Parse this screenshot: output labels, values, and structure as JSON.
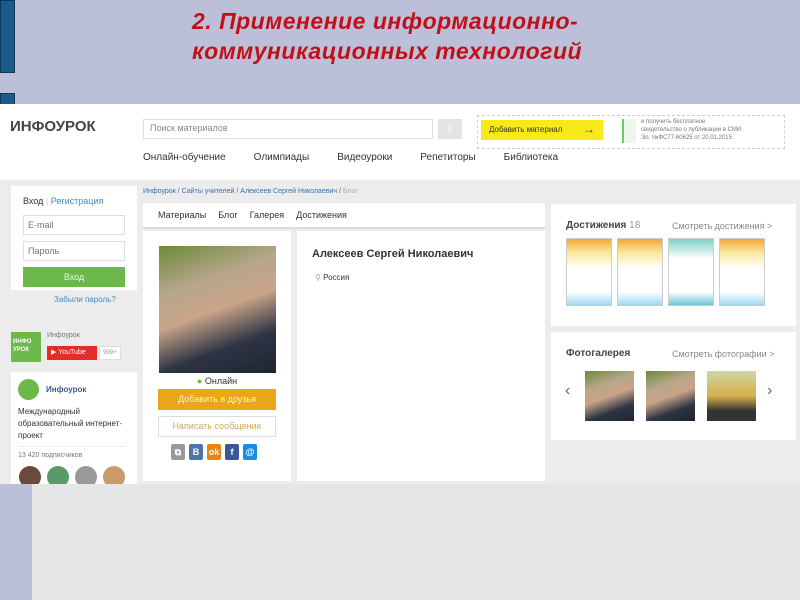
{
  "slide": {
    "title_line1": "2. Применение  информационно-",
    "title_line2": "коммуникационных технологий"
  },
  "site": {
    "logo": "ИНФОУРОК",
    "search_placeholder": "Поиск материалов",
    "add_material": "Добавить материал",
    "promo_text": [
      "и получить бесплатное",
      "свидетельство о публикации в СМИ",
      "Эл. №ФС77-60625 от 20.01.2015"
    ],
    "nav": [
      "Онлайн-обучение",
      "Олимпиады",
      "Видеоуроки",
      "Репетиторы",
      "Библиотека"
    ],
    "breadcrumb": [
      "Инфоурок",
      "Сайты учителей",
      "Алексеев Сергей Николаевич",
      "Блог"
    ],
    "login": {
      "tab_login": "Вход",
      "tab_register": "Регистрация",
      "email_placeholder": "E-mail",
      "password_placeholder": "Пароль",
      "submit": "Вход",
      "forgot": "Забыли пароль?"
    },
    "youtube": {
      "channel": "Инфоурок",
      "logo_text": "ИНФО УРОК",
      "button": "YouTube",
      "count": "999+"
    },
    "community": {
      "name": "Инфоурок",
      "description": "Международный образовательный интернет-проект",
      "subscribers": "13 420 подписчиков"
    },
    "profile_tabs": [
      "Материалы",
      "Блог",
      "Галерея",
      "Достижения"
    ],
    "profile": {
      "name": "Алексеев Сергей Николаевич",
      "location": "Россия",
      "status": "Онлайн",
      "add_friend": "Добавить в друзья",
      "message": "Написать сообщение"
    },
    "achievements": {
      "title": "Достижения",
      "count": "18",
      "link": "Смотреть достижения >"
    },
    "gallery": {
      "title": "Фотогалерея",
      "link": "Смотреть фотографии >",
      "prev": "‹",
      "next": "›"
    },
    "colors": {
      "green": "#6cb94a",
      "yellow": "#f7ea18",
      "orange": "#e8a618",
      "red_title": "#c0101a"
    }
  }
}
